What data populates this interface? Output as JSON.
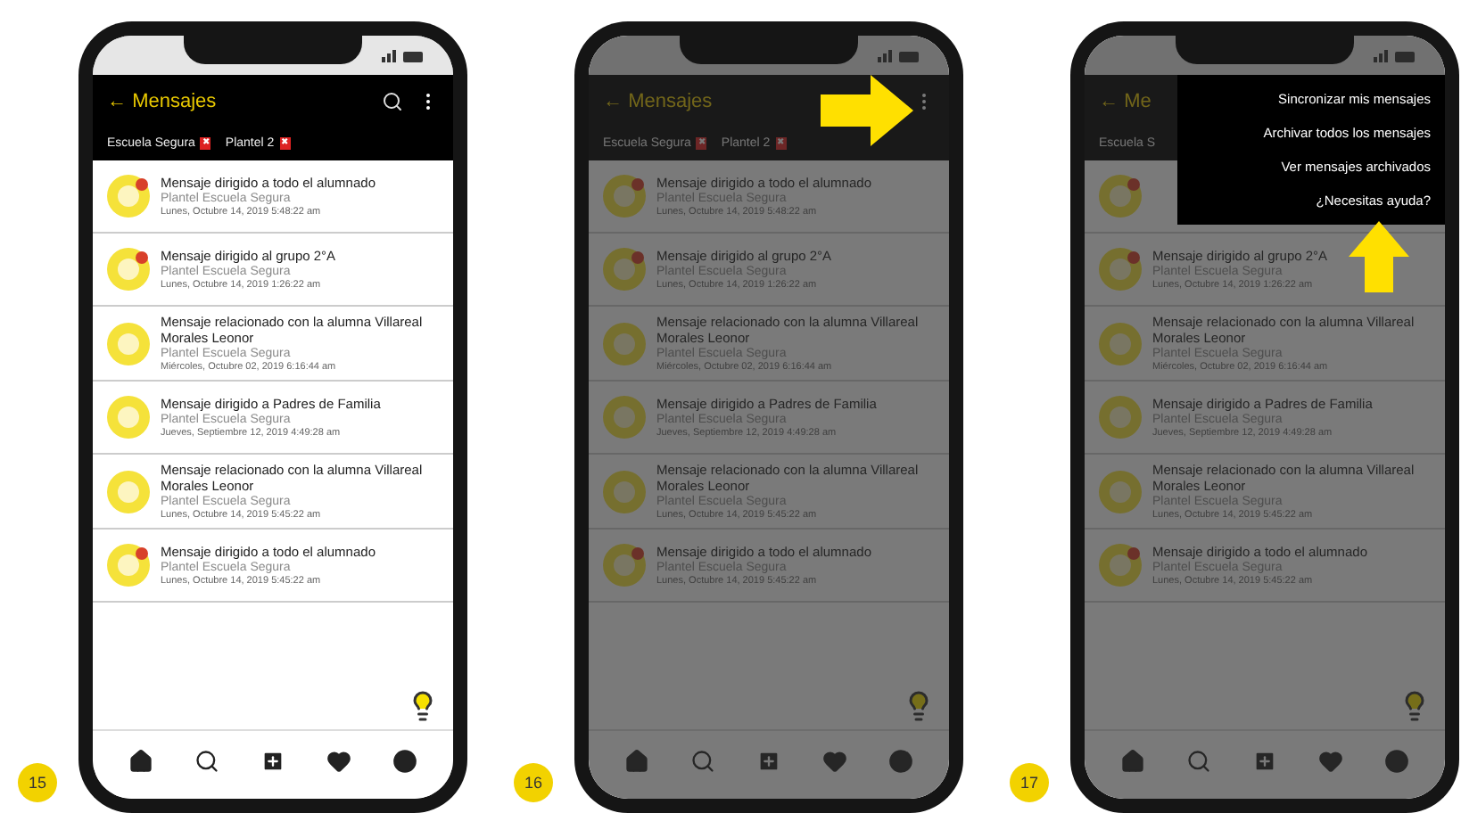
{
  "phones": [
    {
      "step": "15",
      "dimmed": false,
      "back": "←",
      "title": "Mensajes",
      "actions": [
        {
          "kind": "search"
        },
        {
          "kind": "more"
        }
      ],
      "filters": [
        {
          "label": "Escuela Segura",
          "remove": "✖"
        },
        {
          "label": "Plantel 2",
          "remove": "✖"
        }
      ],
      "messages": [
        {
          "title": "Mensaje dirigido a todo el alumnado",
          "school": "Plantel Escuela Segura",
          "date": "Lunes, Octubre 14, 2019 5:48:22 am",
          "unread": true
        },
        {
          "title": "Mensaje dirigido al grupo 2°A",
          "school": "Plantel Escuela Segura",
          "date": "Lunes, Octubre 14, 2019 1:26:22 am",
          "unread": true
        },
        {
          "title": "Mensaje relacionado con la alumna Villareal Morales Leonor",
          "school": "Plantel Escuela Segura",
          "date": "Miércoles, Octubre 02, 2019 6:16:44 am",
          "unread": false
        },
        {
          "title": "Mensaje dirigido a Padres de Familia",
          "school": "Plantel Escuela Segura",
          "date": "Jueves, Septiembre 12, 2019 4:49:28 am",
          "unread": false
        },
        {
          "title": "Mensaje relacionado con la alumna Villareal Morales Leonor",
          "school": "Plantel Escuela Segura",
          "date": "Lunes, Octubre 14, 2019 5:45:22 am",
          "unread": false
        },
        {
          "title": "Mensaje dirigido a todo el alumnado",
          "school": "Plantel Escuela Segura",
          "date": "Lunes, Octubre 14, 2019 5:45:22 am",
          "unread": true
        }
      ]
    },
    {
      "step": "16",
      "dimmed": true,
      "pointer": {
        "kind": "right"
      },
      "back": "←",
      "title": "Mensajes",
      "actions": [
        {
          "kind": "more"
        }
      ],
      "filters": [
        {
          "label": "Escuela Segura",
          "remove": "✖"
        },
        {
          "label": "Plantel 2",
          "remove": "✖"
        }
      ],
      "messages": [
        {
          "title": "Mensaje dirigido a todo el alumnado",
          "school": "Plantel Escuela Segura",
          "date": "Lunes, Octubre 14, 2019 5:48:22 am",
          "unread": true
        },
        {
          "title": "Mensaje dirigido al grupo 2°A",
          "school": "Plantel Escuela Segura",
          "date": "Lunes, Octubre 14, 2019 1:26:22 am",
          "unread": true
        },
        {
          "title": "Mensaje relacionado con la alumna Villareal Morales Leonor",
          "school": "Plantel Escuela Segura",
          "date": "Miércoles, Octubre 02, 2019 6:16:44 am",
          "unread": false
        },
        {
          "title": "Mensaje dirigido a Padres de Familia",
          "school": "Plantel Escuela Segura",
          "date": "Jueves, Septiembre 12, 2019 4:49:28 am",
          "unread": false
        },
        {
          "title": "Mensaje relacionado con la alumna Villareal Morales Leonor",
          "school": "Plantel Escuela Segura",
          "date": "Lunes, Octubre 14, 2019 5:45:22 am",
          "unread": false
        },
        {
          "title": "Mensaje dirigido a todo el alumnado",
          "school": "Plantel Escuela Segura",
          "date": "Lunes, Octubre 14, 2019 5:45:22 am",
          "unread": true
        }
      ]
    },
    {
      "step": "17",
      "dimmed": true,
      "pointer": {
        "kind": "up"
      },
      "back": "←",
      "title": "Me",
      "filters": [
        {
          "label": "Escuela S"
        }
      ],
      "menu": [
        "Sincronizar mis mensajes",
        "Archivar todos los mensajes",
        "Ver mensajes archivados",
        "¿Necesitas ayuda?"
      ],
      "messages": [
        {
          "unread": true
        },
        {
          "title": "Mensaje dirigido al grupo 2°A",
          "school": "Plantel Escuela Segura",
          "date": "Lunes, Octubre 14, 2019 1:26:22 am",
          "unread": true
        },
        {
          "title": "Mensaje relacionado con la alumna Villareal Morales Leonor",
          "school": "Plantel Escuela Segura",
          "date": "Miércoles, Octubre 02, 2019 6:16:44 am",
          "unread": false
        },
        {
          "title": "Mensaje dirigido a Padres de Familia",
          "school": "Plantel Escuela Segura",
          "date": "Jueves, Septiembre 12, 2019 4:49:28 am",
          "unread": false
        },
        {
          "title": "Mensaje relacionado con la alumna Villareal Morales Leonor",
          "school": "Plantel Escuela Segura",
          "date": "Lunes, Octubre 14, 2019 5:45:22 am",
          "unread": false
        },
        {
          "title": "Mensaje dirigido a todo el alumnado",
          "school": "Plantel Escuela Segura",
          "date": "Lunes, Octubre 14, 2019 5:45:22 am",
          "unread": true
        }
      ]
    }
  ]
}
